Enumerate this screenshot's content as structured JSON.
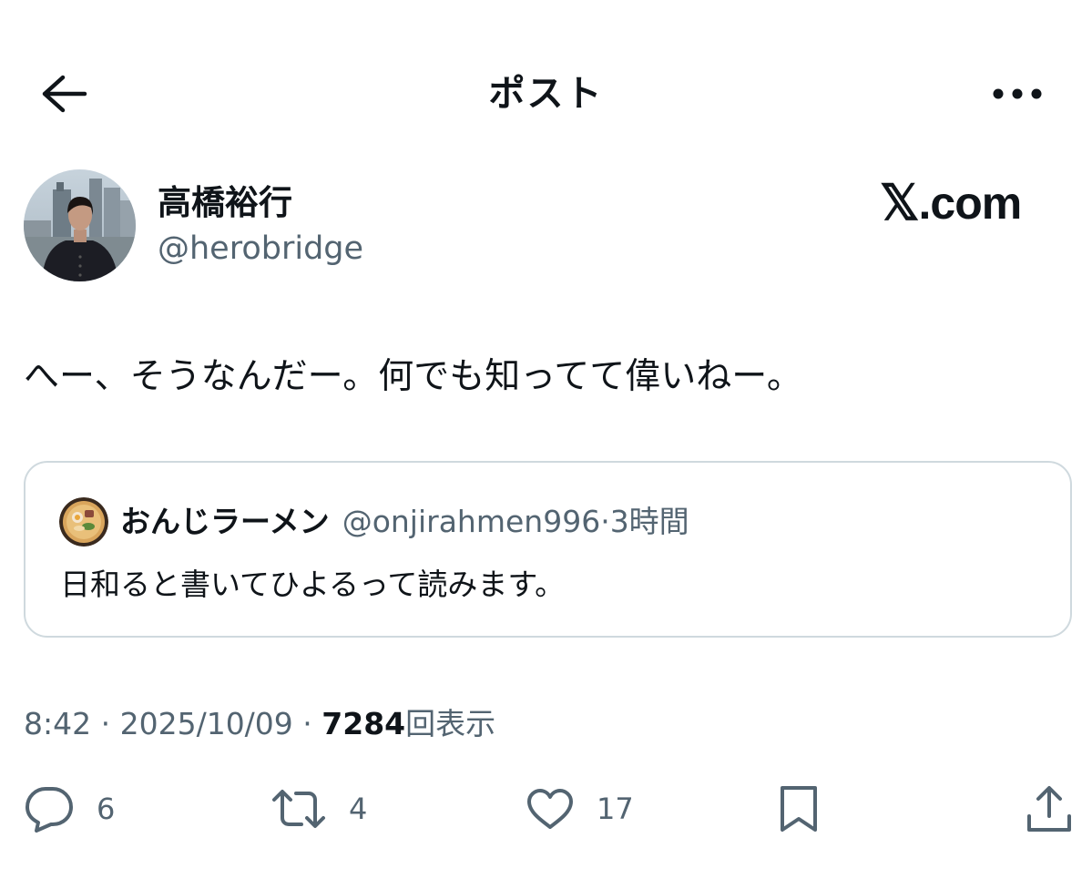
{
  "header": {
    "title": "ポスト",
    "back_icon": "arrow-left-icon",
    "more_icon": "more-horizontal-icon"
  },
  "author": {
    "name": "高橋裕行",
    "handle": "@herobridge"
  },
  "watermark": {
    "x_glyph": "𝕏",
    "text": ".com"
  },
  "post": {
    "text": "へー、そうなんだー。何でも知ってて偉いねー。"
  },
  "quote": {
    "name": "おんじラーメン",
    "handle": "@onjirahmen996",
    "separator": "·",
    "time": "3時間",
    "text": "日和ると書いてひよるって読みます。"
  },
  "meta": {
    "time": "8:42",
    "sep1": " · ",
    "date": "2025/10/09",
    "sep2": " · ",
    "views": "7284",
    "views_label": "回表示"
  },
  "actions": {
    "reply_count": "6",
    "repost_count": "4",
    "like_count": "17"
  },
  "colors": {
    "text": "#0f1419",
    "secondary": "#536471",
    "border": "#cfd9de"
  }
}
